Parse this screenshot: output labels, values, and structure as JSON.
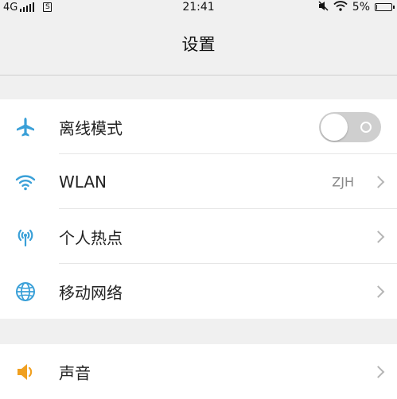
{
  "status_bar": {
    "network": "4G",
    "sim_label": "S",
    "time": "21:41",
    "battery": "5%"
  },
  "header": {
    "title": "设置"
  },
  "section1": {
    "items": [
      {
        "label": "离线模式",
        "icon": "airplane-icon"
      },
      {
        "label": "WLAN",
        "value": "ZJH",
        "icon": "wifi-icon"
      },
      {
        "label": "个人热点",
        "icon": "hotspot-icon"
      },
      {
        "label": "移动网络",
        "icon": "globe-icon"
      }
    ]
  },
  "section2": {
    "items": [
      {
        "label": "声音",
        "icon": "speaker-icon"
      }
    ]
  },
  "colors": {
    "accent": "#3aa0d8",
    "toggle_off": "#cfcfcf",
    "speaker": "#f0a020"
  }
}
